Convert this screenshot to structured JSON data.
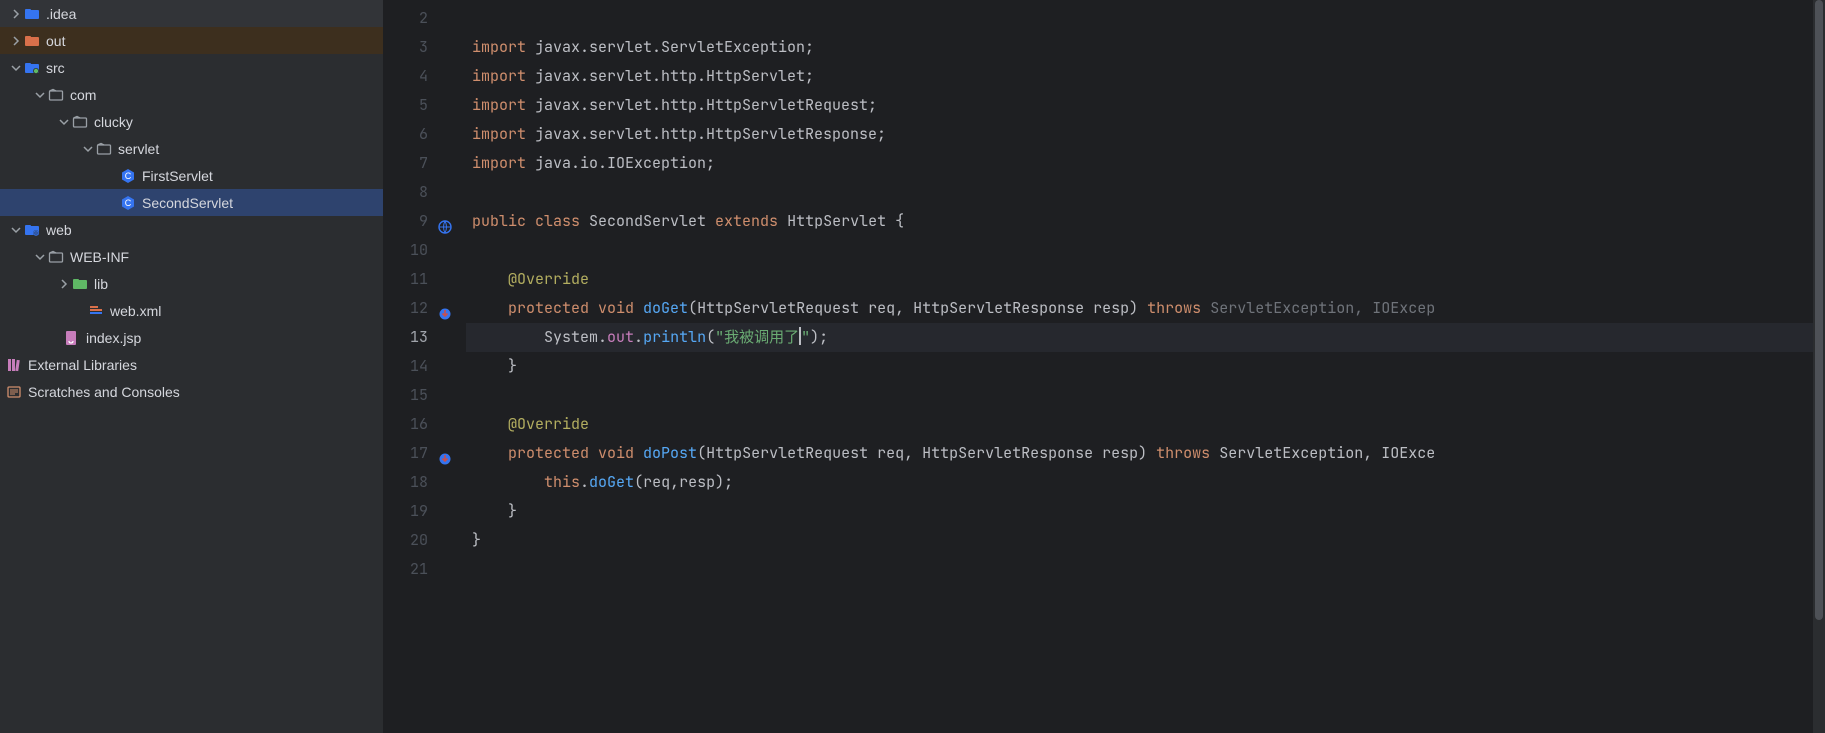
{
  "tree": {
    "idea": ".idea",
    "out": "out",
    "src": "src",
    "com": "com",
    "clucky": "clucky",
    "servlet": "servlet",
    "first": "FirstServlet",
    "second": "SecondServlet",
    "web": "web",
    "webinf": "WEB-INF",
    "lib": "lib",
    "webxml": "web.xml",
    "indexjsp": "index.jsp",
    "extlibs": "External Libraries",
    "scratches": "Scratches and Consoles"
  },
  "lines": {
    "n2": "2",
    "n3": "3",
    "n4": "4",
    "n5": "5",
    "n6": "6",
    "n7": "7",
    "n8": "8",
    "n9": "9",
    "n10": "10",
    "n11": "11",
    "n12": "12",
    "n13": "13",
    "n14": "14",
    "n15": "15",
    "n16": "16",
    "n17": "17",
    "n18": "18",
    "n19": "19",
    "n20": "20",
    "n21": "21"
  },
  "code": {
    "l3": {
      "kw": "import ",
      "p": "javax.servlet.ServletException;",
      "indent": ""
    },
    "l4": {
      "kw": "import ",
      "p": "javax.servlet.http.HttpServlet;"
    },
    "l5": {
      "kw": "import ",
      "p": "javax.servlet.http.HttpServletRequest;"
    },
    "l6": {
      "kw": "import ",
      "p": "javax.servlet.http.HttpServletResponse;"
    },
    "l7": {
      "kw": "import ",
      "p": "java.io.IOException;"
    },
    "l9": {
      "pub": "public ",
      "cls": "class ",
      "name": "SecondServlet ",
      "ext": "extends ",
      "sup": "HttpServlet ",
      "br": "{"
    },
    "l11": {
      "ann": "@Override"
    },
    "l12": {
      "prot": "protected ",
      "void": "void ",
      "m": "doGet",
      "op": "(",
      "t1": "HttpServletRequest ",
      "a1": "req",
      "c1": ", ",
      "t2": "HttpServletResponse ",
      "a2": "resp",
      "cp": ") ",
      "thr": "throws ",
      "e1": "ServletException",
      "c2": ", ",
      "e2": "IOExcep"
    },
    "l13": {
      "sys": "System.",
      "out": "out",
      "dot": ".",
      "prn": "println",
      "op": "(",
      "s": "\"我被调用了",
      "s2": "\"",
      "cp": ");"
    },
    "l14": {
      "br": "}"
    },
    "l16": {
      "ann": "@Override"
    },
    "l17": {
      "prot": "protected ",
      "void": "void ",
      "m": "doPost",
      "op": "(",
      "t1": "HttpServletRequest ",
      "a1": "req",
      "c1": ", ",
      "t2": "HttpServletResponse ",
      "a2": "resp",
      "cp": ") ",
      "thr": "throws ",
      "e1": "ServletException",
      "c2": ", ",
      "e2": "IOExce"
    },
    "l18": {
      "this": "this",
      "dot": ".",
      "m": "doGet",
      "op": "(",
      "a1": "req",
      "c": ",",
      "a2": "resp",
      "cp": ");"
    },
    "l19": {
      "br": "}"
    },
    "l20": {
      "br": "}"
    }
  }
}
